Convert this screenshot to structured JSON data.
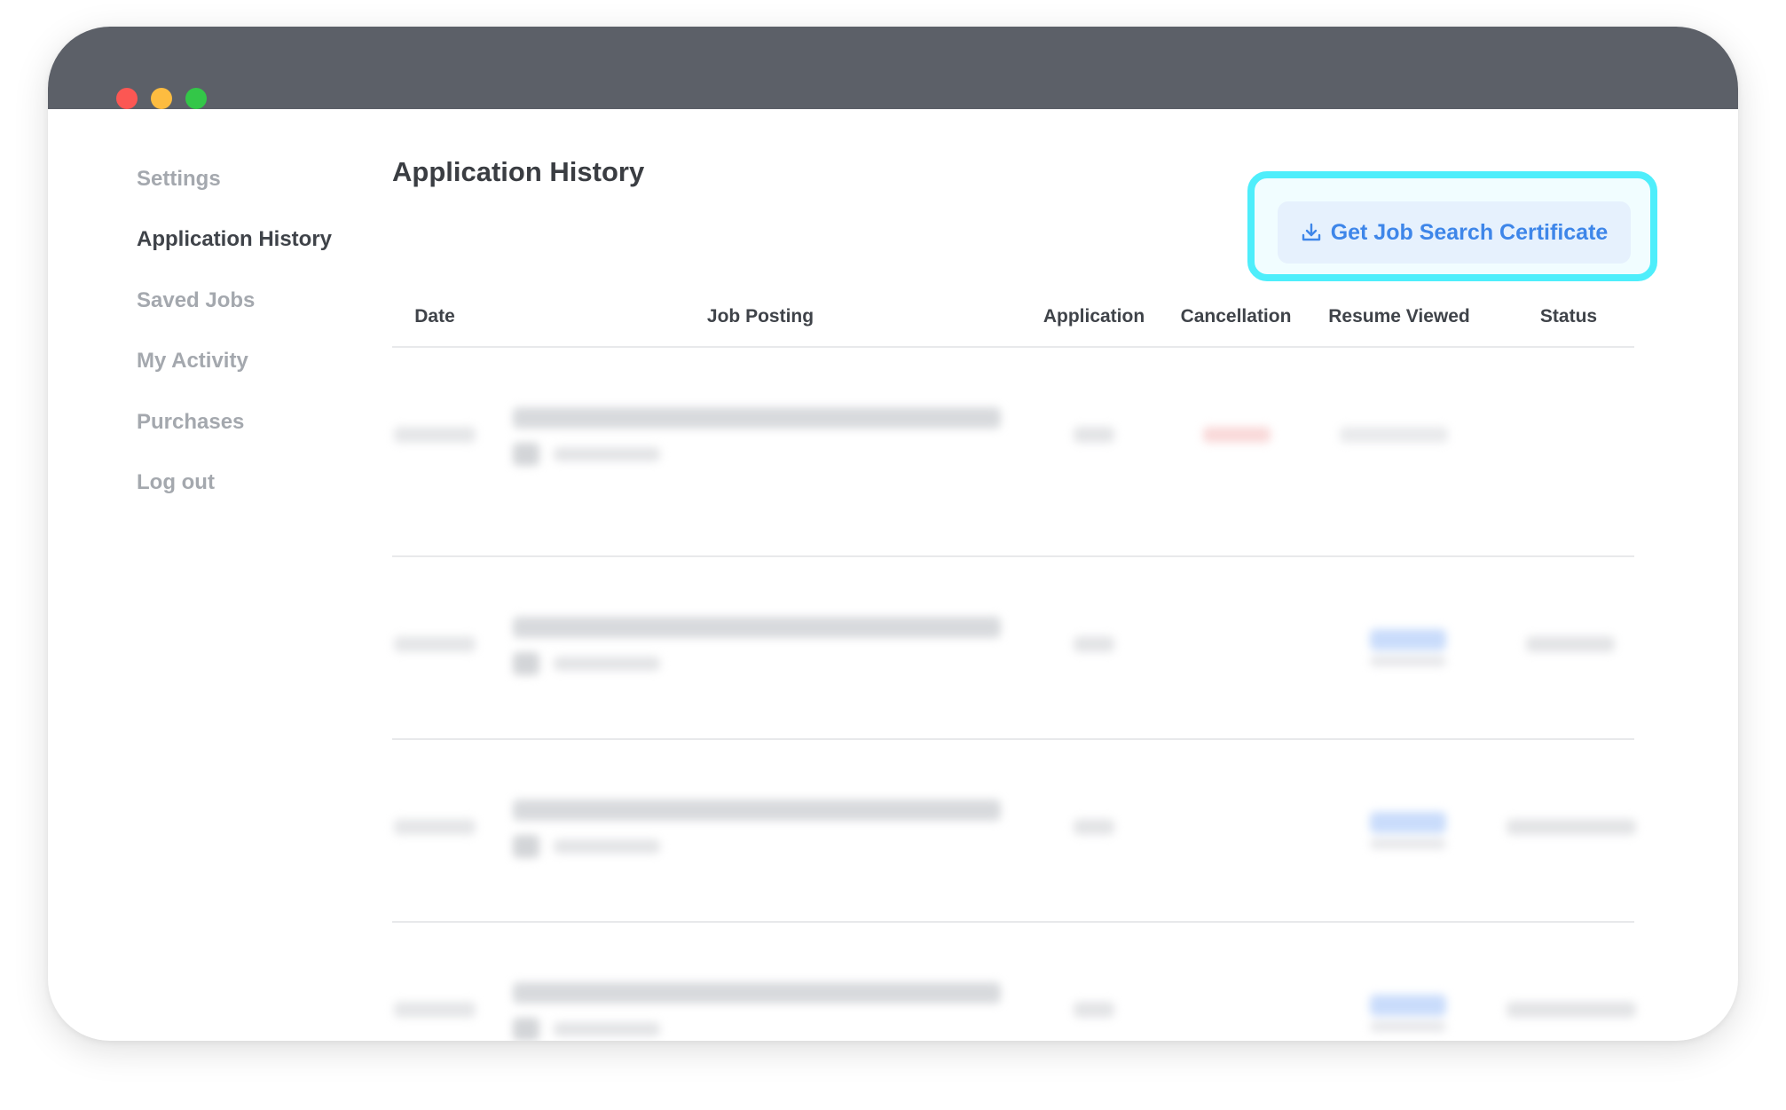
{
  "window": {
    "controls": [
      "close",
      "minimize",
      "maximize"
    ],
    "colors": {
      "titlebar": "#5c6068",
      "close": "#fc5753",
      "minimize": "#fdbc40",
      "maximize": "#33c748"
    }
  },
  "sidebar": {
    "items": [
      {
        "label": "Settings",
        "active": false
      },
      {
        "label": "Application History",
        "active": true
      },
      {
        "label": "Saved Jobs",
        "active": false
      },
      {
        "label": "My Activity",
        "active": false
      },
      {
        "label": "Purchases",
        "active": false
      },
      {
        "label": "Log out",
        "active": false
      }
    ]
  },
  "main": {
    "title": "Application History",
    "certificate_button": {
      "label": "Get Job Search Certificate",
      "icon": "download-icon",
      "highlighted": true
    },
    "table": {
      "columns": [
        "Date",
        "Job Posting",
        "Application",
        "Cancellation",
        "Resume Viewed",
        "Status"
      ],
      "rows_blurred": true,
      "row_count": 4
    }
  },
  "colors": {
    "accent": "#3e86e9",
    "highlight": "#4eeefb",
    "button_bg": "#e6f1fd",
    "text_dark": "#3f4349",
    "text_muted": "#a4a8ae"
  }
}
